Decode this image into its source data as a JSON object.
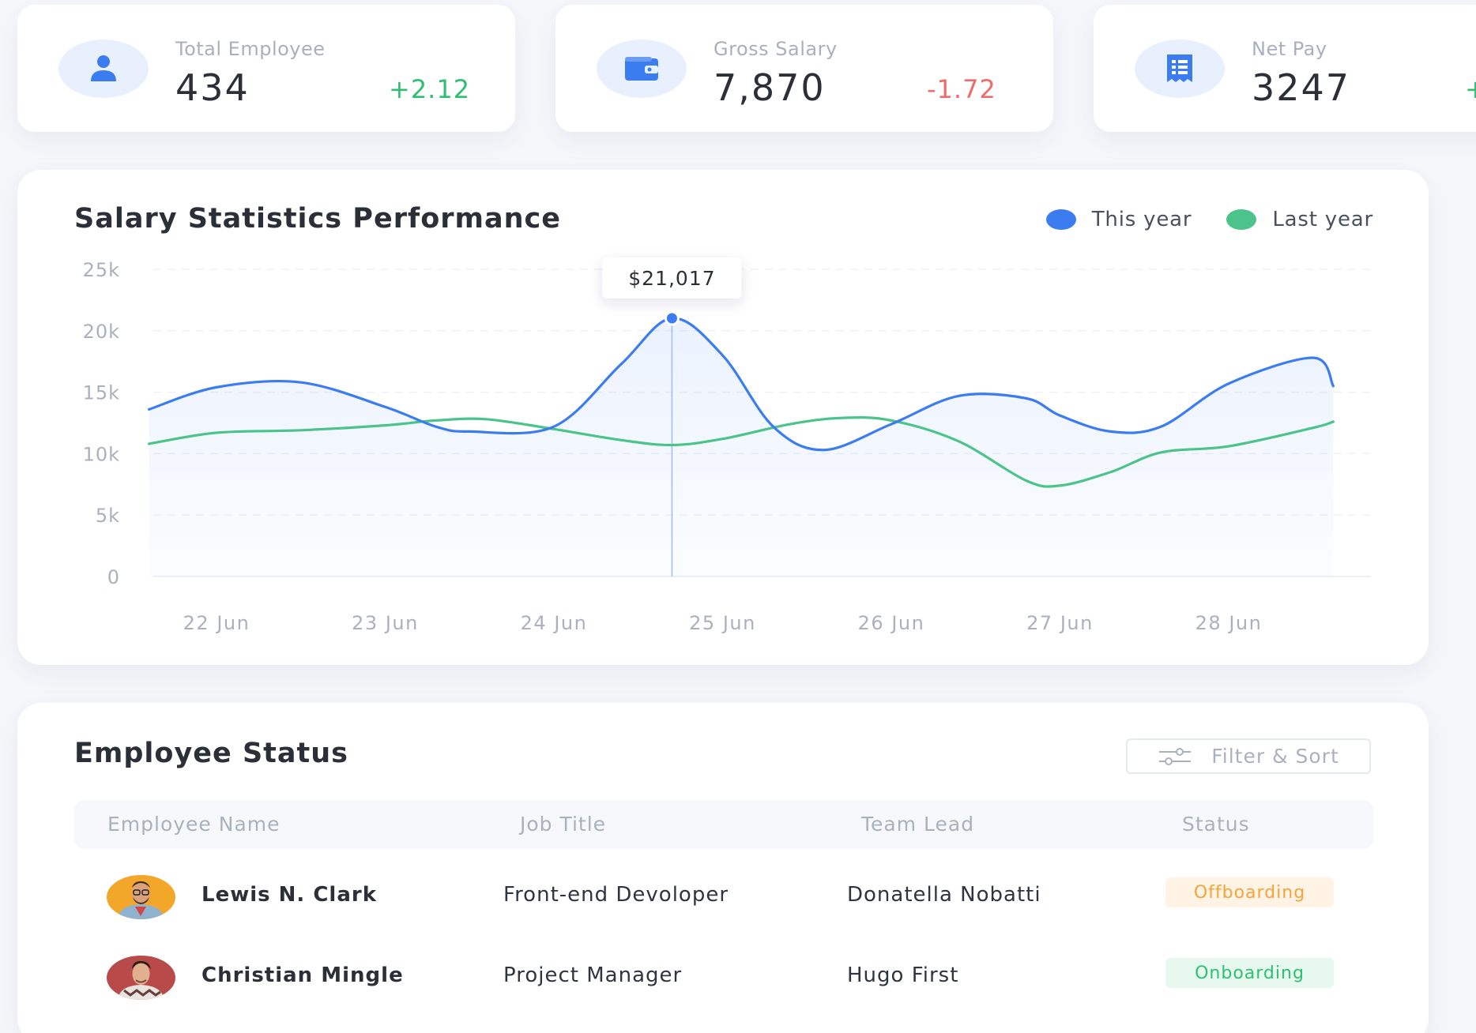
{
  "kpis": [
    {
      "label": "Total Employee",
      "value": "434",
      "delta": "+2.12",
      "icon": "user-icon"
    },
    {
      "label": "Gross Salary",
      "value": "7,870",
      "delta": "-1.72",
      "icon": "wallet-icon"
    },
    {
      "label": "Net Pay",
      "value": "3247",
      "delta": "+",
      "icon": "receipt-icon"
    }
  ],
  "colors": {
    "accent": "#3b7cf0",
    "green": "#4cc38a",
    "positive": "#2fbf71",
    "negative": "#ee6b6b",
    "offboarding": "#f5a43a"
  },
  "chart_data": {
    "type": "line",
    "title": "Salary Statistics Performance",
    "legend": {
      "position": "top-right"
    },
    "categories": [
      "22 Jun",
      "23 Jun",
      "24 Jun",
      "25 Jun",
      "26 Jun",
      "27 Jun",
      "28 Jun"
    ],
    "y_ticks": [
      "0",
      "5k",
      "10k",
      "15k",
      "20k",
      "25k"
    ],
    "ylim": [
      0,
      25000
    ],
    "grid": true,
    "series": [
      {
        "name": "This year",
        "color": "#3b7cf0",
        "x": [
          21.6,
          22.0,
          22.5,
          23.0,
          23.3,
          23.5,
          24.0,
          24.4,
          24.7,
          25.0,
          25.3,
          25.6,
          26.0,
          26.4,
          26.8,
          27.0,
          27.3,
          27.6,
          28.0,
          28.5
        ],
        "y": [
          13600,
          15400,
          15800,
          13800,
          12200,
          11800,
          12200,
          17300,
          21017,
          18000,
          12200,
          10300,
          12400,
          14700,
          14500,
          13100,
          11800,
          12200,
          15700,
          17800
        ]
      },
      {
        "name": "Last year",
        "color": "#4cc38a",
        "x": [
          21.6,
          22.0,
          22.5,
          23.0,
          23.3,
          23.6,
          24.0,
          24.4,
          24.7,
          25.0,
          25.4,
          25.7,
          26.0,
          26.4,
          26.8,
          27.0,
          27.3,
          27.6,
          28.0,
          28.5
        ],
        "y": [
          10800,
          11700,
          11900,
          12300,
          12700,
          12800,
          12000,
          11100,
          10700,
          11200,
          12400,
          12900,
          12700,
          11000,
          7800,
          7400,
          8500,
          10100,
          10600,
          12100
        ]
      }
    ],
    "tooltip": {
      "x": 24.7,
      "value": 21017,
      "label": "$21,017"
    },
    "last_points": {
      "This year": 15500,
      "Last year": 12600
    }
  },
  "table": {
    "title": "Employee Status",
    "filter_label": "Filter & Sort",
    "headers": [
      "Employee Name",
      "Job Title",
      "Team Lead",
      "Status"
    ],
    "rows": [
      {
        "name": "Lewis N. Clark",
        "job": "Front-end Devoloper",
        "lead": "Donatella Nobatti",
        "status": "Offboarding"
      },
      {
        "name": "Christian Mingle",
        "job": "Project Manager",
        "lead": "Hugo First",
        "status": "Onboarding"
      }
    ]
  }
}
